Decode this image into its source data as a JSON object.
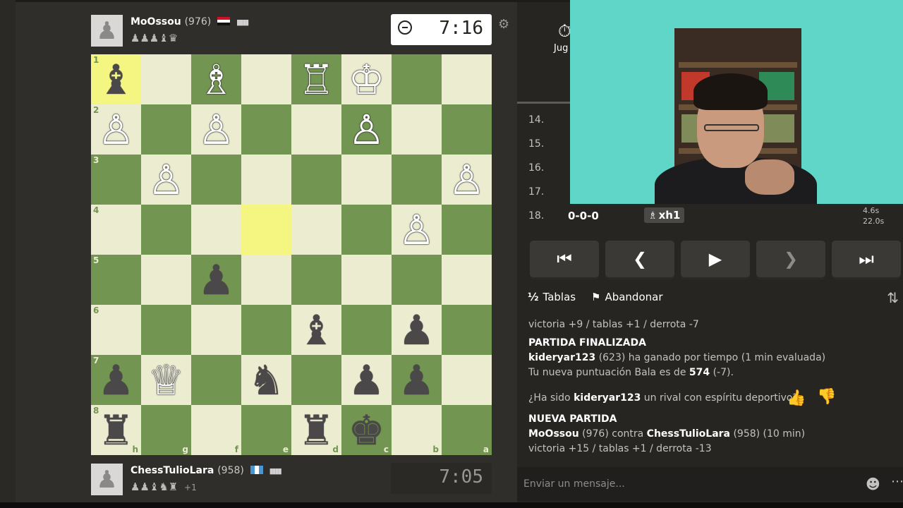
{
  "top_player": {
    "name": "MoOssou",
    "rating": "(976)",
    "captured": "♟♟♟♝♛"
  },
  "top_clock": "7:16",
  "bottom_player": {
    "name": "ChessTulioLara",
    "rating": "(958)",
    "captured": "♟♟♝♞♜",
    "advantage": "+1"
  },
  "bottom_clock": "7:05",
  "right_top": {
    "label": "Jug"
  },
  "moves": [
    {
      "num": "14."
    },
    {
      "num": "15."
    },
    {
      "num": "16."
    },
    {
      "num": "17."
    },
    {
      "num": "18.",
      "white": "0-0-0",
      "black": "xh1",
      "times": [
        "4.6s",
        "22.0s"
      ]
    }
  ],
  "actions": {
    "draw_icon": "½",
    "draw_label": "Tablas",
    "resign_label": "Abandonar"
  },
  "chat": {
    "line1": "victoria +9 / tablas +1 / derrota -7",
    "ended_title": "PARTIDA FINALIZADA",
    "winner": "kideryar123",
    "winner_text": "(623) ha ganado por tiempo (1 min evaluada)",
    "rating_text_1": "Tu nueva puntuación Bala es de",
    "rating_value": "574",
    "rating_text_2": "(-7).",
    "sport_q1": "¿Ha sido",
    "sport_name": "kideryar123",
    "sport_q2": "un rival con espíritu deportivo?",
    "new_title": "NUEVA PARTIDA",
    "new_p1": "MoOssou",
    "new_p1_rating": "(976) contra",
    "new_p2": "ChessTulioLara",
    "new_p2_rating": "(958) (10 min)",
    "line_last": "victoria +15 / tablas +1 / derrota -13"
  },
  "message_placeholder": "Enviar un mensaje...",
  "board": {
    "ranks": [
      "1",
      "2",
      "3",
      "4",
      "5",
      "6",
      "7",
      "8"
    ],
    "files": [
      "h",
      "g",
      "f",
      "e",
      "d",
      "c",
      "b",
      "a"
    ],
    "pieces": [
      {
        "sq": "0-0",
        "p": "♝",
        "c": "b",
        "name": "black-bishop"
      },
      {
        "sq": "0-2",
        "p": "♗",
        "c": "w",
        "name": "white-bishop"
      },
      {
        "sq": "0-4",
        "p": "♖",
        "c": "w",
        "name": "white-rook"
      },
      {
        "sq": "0-5",
        "p": "♔",
        "c": "w",
        "name": "white-king"
      },
      {
        "sq": "1-0",
        "p": "♙",
        "c": "w",
        "name": "white-pawn"
      },
      {
        "sq": "1-2",
        "p": "♙",
        "c": "w",
        "name": "white-pawn"
      },
      {
        "sq": "1-5",
        "p": "♙",
        "c": "w",
        "name": "white-pawn"
      },
      {
        "sq": "2-1",
        "p": "♙",
        "c": "w",
        "name": "white-pawn"
      },
      {
        "sq": "2-7",
        "p": "♙",
        "c": "w",
        "name": "white-pawn"
      },
      {
        "sq": "3-6",
        "p": "♙",
        "c": "w",
        "name": "white-pawn"
      },
      {
        "sq": "4-2",
        "p": "♟",
        "c": "b",
        "name": "black-pawn"
      },
      {
        "sq": "5-4",
        "p": "♝",
        "c": "b",
        "name": "black-bishop"
      },
      {
        "sq": "5-6",
        "p": "♟",
        "c": "b",
        "name": "black-pawn"
      },
      {
        "sq": "6-0",
        "p": "♟",
        "c": "b",
        "name": "black-pawn"
      },
      {
        "sq": "6-1",
        "p": "♕",
        "c": "w",
        "name": "white-queen"
      },
      {
        "sq": "6-3",
        "p": "♞",
        "c": "b",
        "name": "black-knight"
      },
      {
        "sq": "6-5",
        "p": "♟",
        "c": "b",
        "name": "black-pawn"
      },
      {
        "sq": "6-6",
        "p": "♟",
        "c": "b",
        "name": "black-pawn"
      },
      {
        "sq": "7-0",
        "p": "♜",
        "c": "b",
        "name": "black-rook"
      },
      {
        "sq": "7-4",
        "p": "♜",
        "c": "b",
        "name": "black-rook"
      },
      {
        "sq": "7-5",
        "p": "♚",
        "c": "b",
        "name": "black-king"
      }
    ],
    "highlights": [
      "0-0",
      "3-3"
    ]
  },
  "colors": {
    "light_square": "#ebecd0",
    "dark_square": "#739552",
    "highlight": "#f5f682",
    "panel": "#262522",
    "background": "#302e2b"
  }
}
